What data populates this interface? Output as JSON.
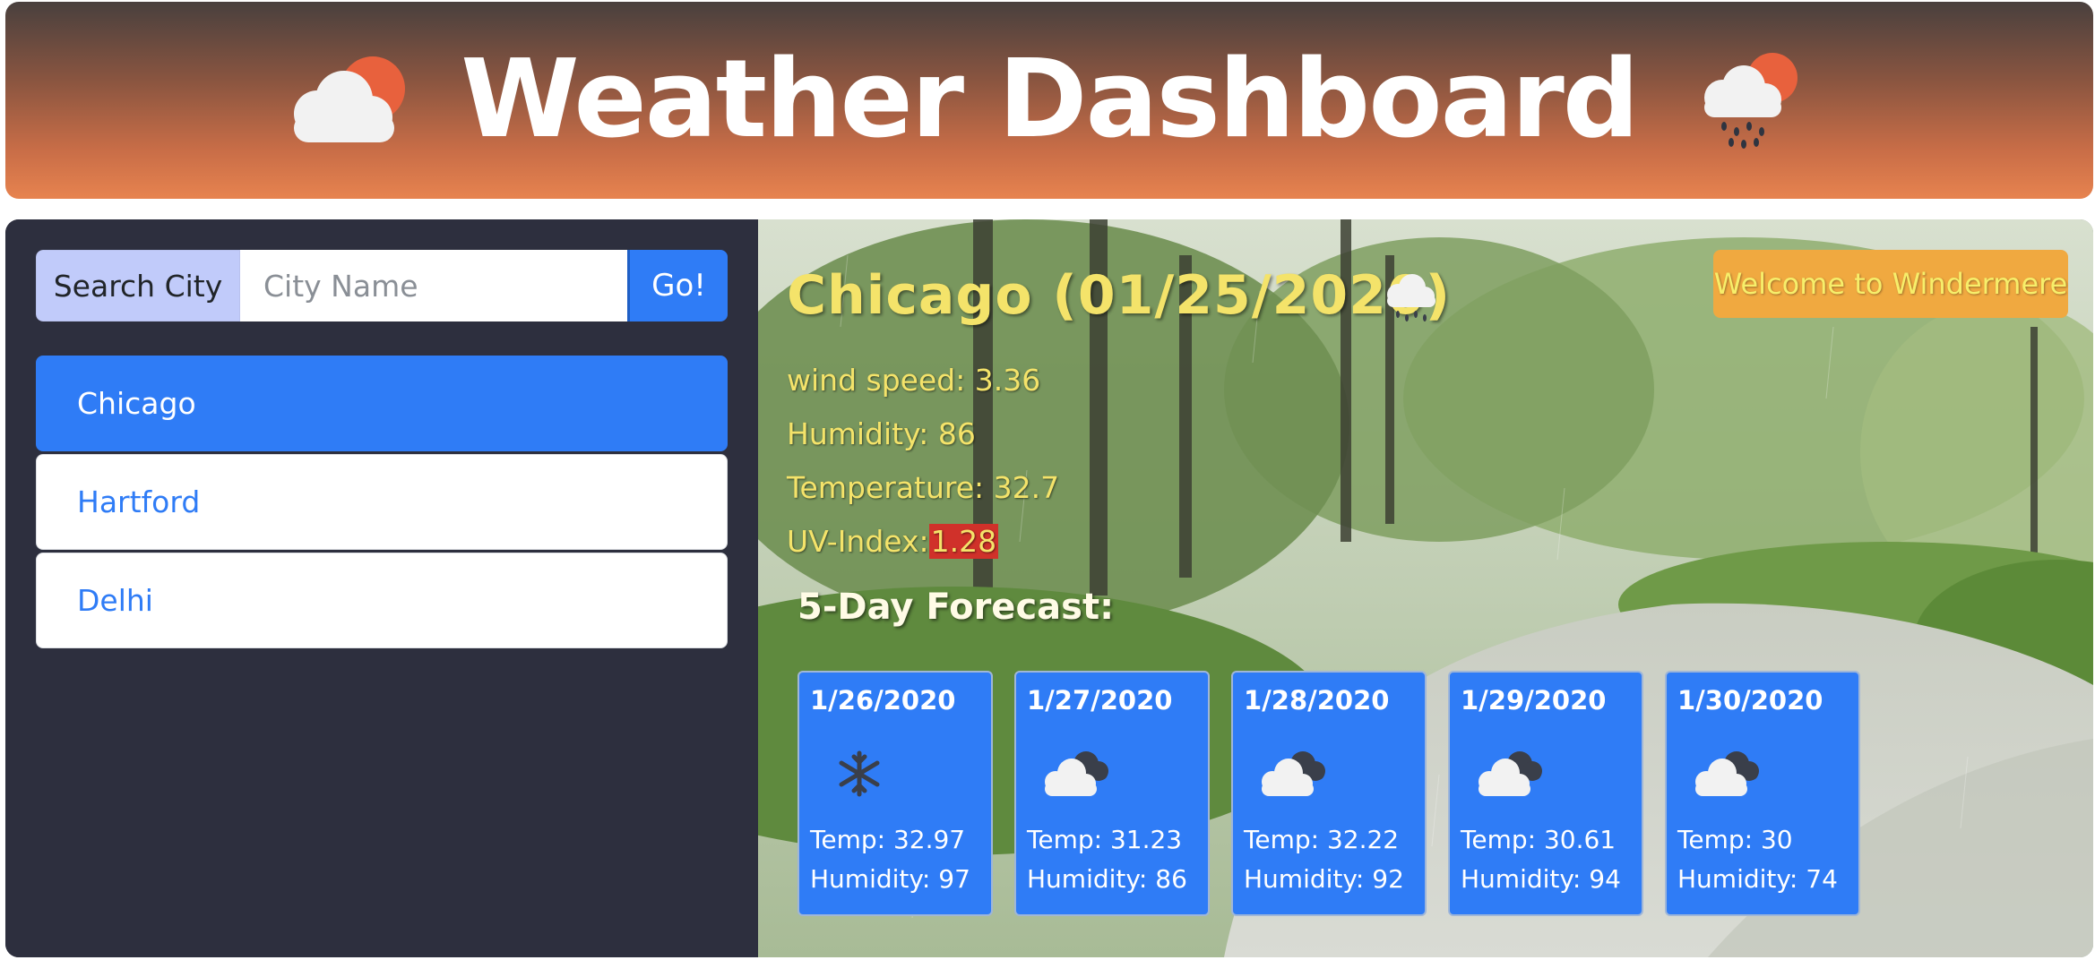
{
  "header": {
    "title": "Weather Dashboard",
    "left_icon": "cloud-sun-icon",
    "right_icon": "cloud-sun-rain-icon"
  },
  "search": {
    "label": "Search City",
    "placeholder": "City Name",
    "value": "",
    "button_label": "Go!"
  },
  "cities": [
    {
      "name": "Chicago",
      "active": true
    },
    {
      "name": "Hartford",
      "active": false
    },
    {
      "name": "Delhi",
      "active": false
    }
  ],
  "current": {
    "title": "Chicago (01/25/2020)",
    "icon": "cloud-rain-icon",
    "wind": "wind speed: 3.36",
    "humidity": "Humidity: 86",
    "temperature": "Temperature: 32.7",
    "uv_label": "UV-Index:",
    "uv_value": "1.28"
  },
  "welcome": "Welcome to Windermere",
  "forecast_heading": "5-Day Forecast:",
  "forecast": [
    {
      "date": "1/26/2020",
      "icon": "snowflake-icon",
      "temp": "Temp: 32.97",
      "humidity": "Humidity: 97"
    },
    {
      "date": "1/27/2020",
      "icon": "broken-clouds-icon",
      "temp": "Temp: 31.23",
      "humidity": "Humidity: 86"
    },
    {
      "date": "1/28/2020",
      "icon": "broken-clouds-icon",
      "temp": "Temp: 32.22",
      "humidity": "Humidity: 92"
    },
    {
      "date": "1/29/2020",
      "icon": "broken-clouds-icon",
      "temp": "Temp: 30.61",
      "humidity": "Humidity: 94"
    },
    {
      "date": "1/30/2020",
      "icon": "broken-clouds-icon",
      "temp": "Temp: 30",
      "humidity": "Humidity: 74"
    }
  ],
  "colors": {
    "accent": "#2f7cf6",
    "highlight_text": "#f4e36a",
    "uv_badge": "#d0312a",
    "welcome_bg": "#f0a940",
    "sidebar_bg": "#2d2f3e"
  }
}
